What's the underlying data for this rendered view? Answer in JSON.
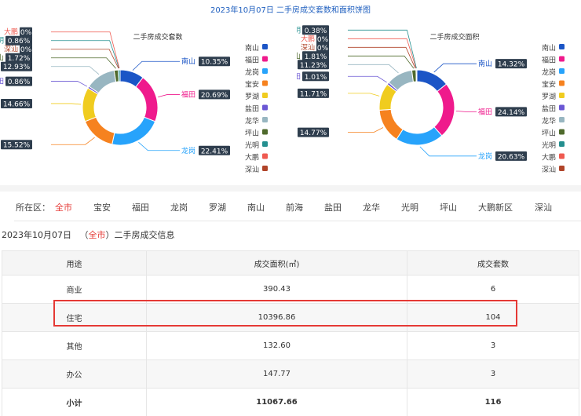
{
  "page_title": "2023年10月07日 二手房成交套数和面积饼图",
  "chart_data": [
    {
      "type": "pie",
      "title": "二手房成交套数",
      "legend_position": "right",
      "categories": [
        "南山",
        "福田",
        "龙岗",
        "宝安",
        "罗湖",
        "盐田",
        "龙华",
        "坪山",
        "光明",
        "大鹏",
        "深汕"
      ],
      "values": [
        10.35,
        20.69,
        22.41,
        15.52,
        14.66,
        0.86,
        12.93,
        1.72,
        0.86,
        0,
        0
      ],
      "labels": [
        "10.35%",
        "20.69%",
        "22.41%",
        "15.52%",
        "14.66%",
        "0.86%",
        "12.93%",
        "1.72%",
        "0.86%",
        "0%",
        "0%"
      ]
    },
    {
      "type": "pie",
      "title": "二手房成交面积",
      "legend_position": "right",
      "categories": [
        "南山",
        "福田",
        "龙岗",
        "宝安",
        "罗湖",
        "盐田",
        "龙华",
        "坪山",
        "光明",
        "大鹏",
        "深汕"
      ],
      "values": [
        14.32,
        24.14,
        20.63,
        14.77,
        11.71,
        1.01,
        11.23,
        1.81,
        0.38,
        0,
        0
      ],
      "labels": [
        "14.32%",
        "24.14%",
        "20.63%",
        "14.77%",
        "11.71%",
        "1.01%",
        "11.23%",
        "1.81%",
        "0.38%",
        "0%",
        "0%"
      ]
    }
  ],
  "colors": [
    "#1b55c6",
    "#ef1a8c",
    "#27a3fb",
    "#f6821f",
    "#f0cc1f",
    "#6b57d4",
    "#98b6c1",
    "#4f6a2c",
    "#248f8f",
    "#ef5a50",
    "#b04429"
  ],
  "filter": {
    "label": "所在区：",
    "items": [
      "全市",
      "宝安",
      "福田",
      "龙岗",
      "罗湖",
      "南山",
      "前海",
      "盐田",
      "龙华",
      "光明",
      "坪山",
      "大鹏新区",
      "深汕"
    ],
    "active": "全市"
  },
  "info": {
    "date": "2023年10月07日",
    "open": "（",
    "district": "全市",
    "close": "）二手房成交信息"
  },
  "table": {
    "headers": [
      "用途",
      "成交面积(㎡)",
      "成交套数"
    ],
    "rows": [
      [
        "商业",
        "390.43",
        "6"
      ],
      [
        "住宅",
        "10396.86",
        "104"
      ],
      [
        "其他",
        "132.60",
        "3"
      ],
      [
        "办公",
        "147.77",
        "3"
      ]
    ],
    "total": [
      "小计",
      "11067.66",
      "116"
    ]
  }
}
